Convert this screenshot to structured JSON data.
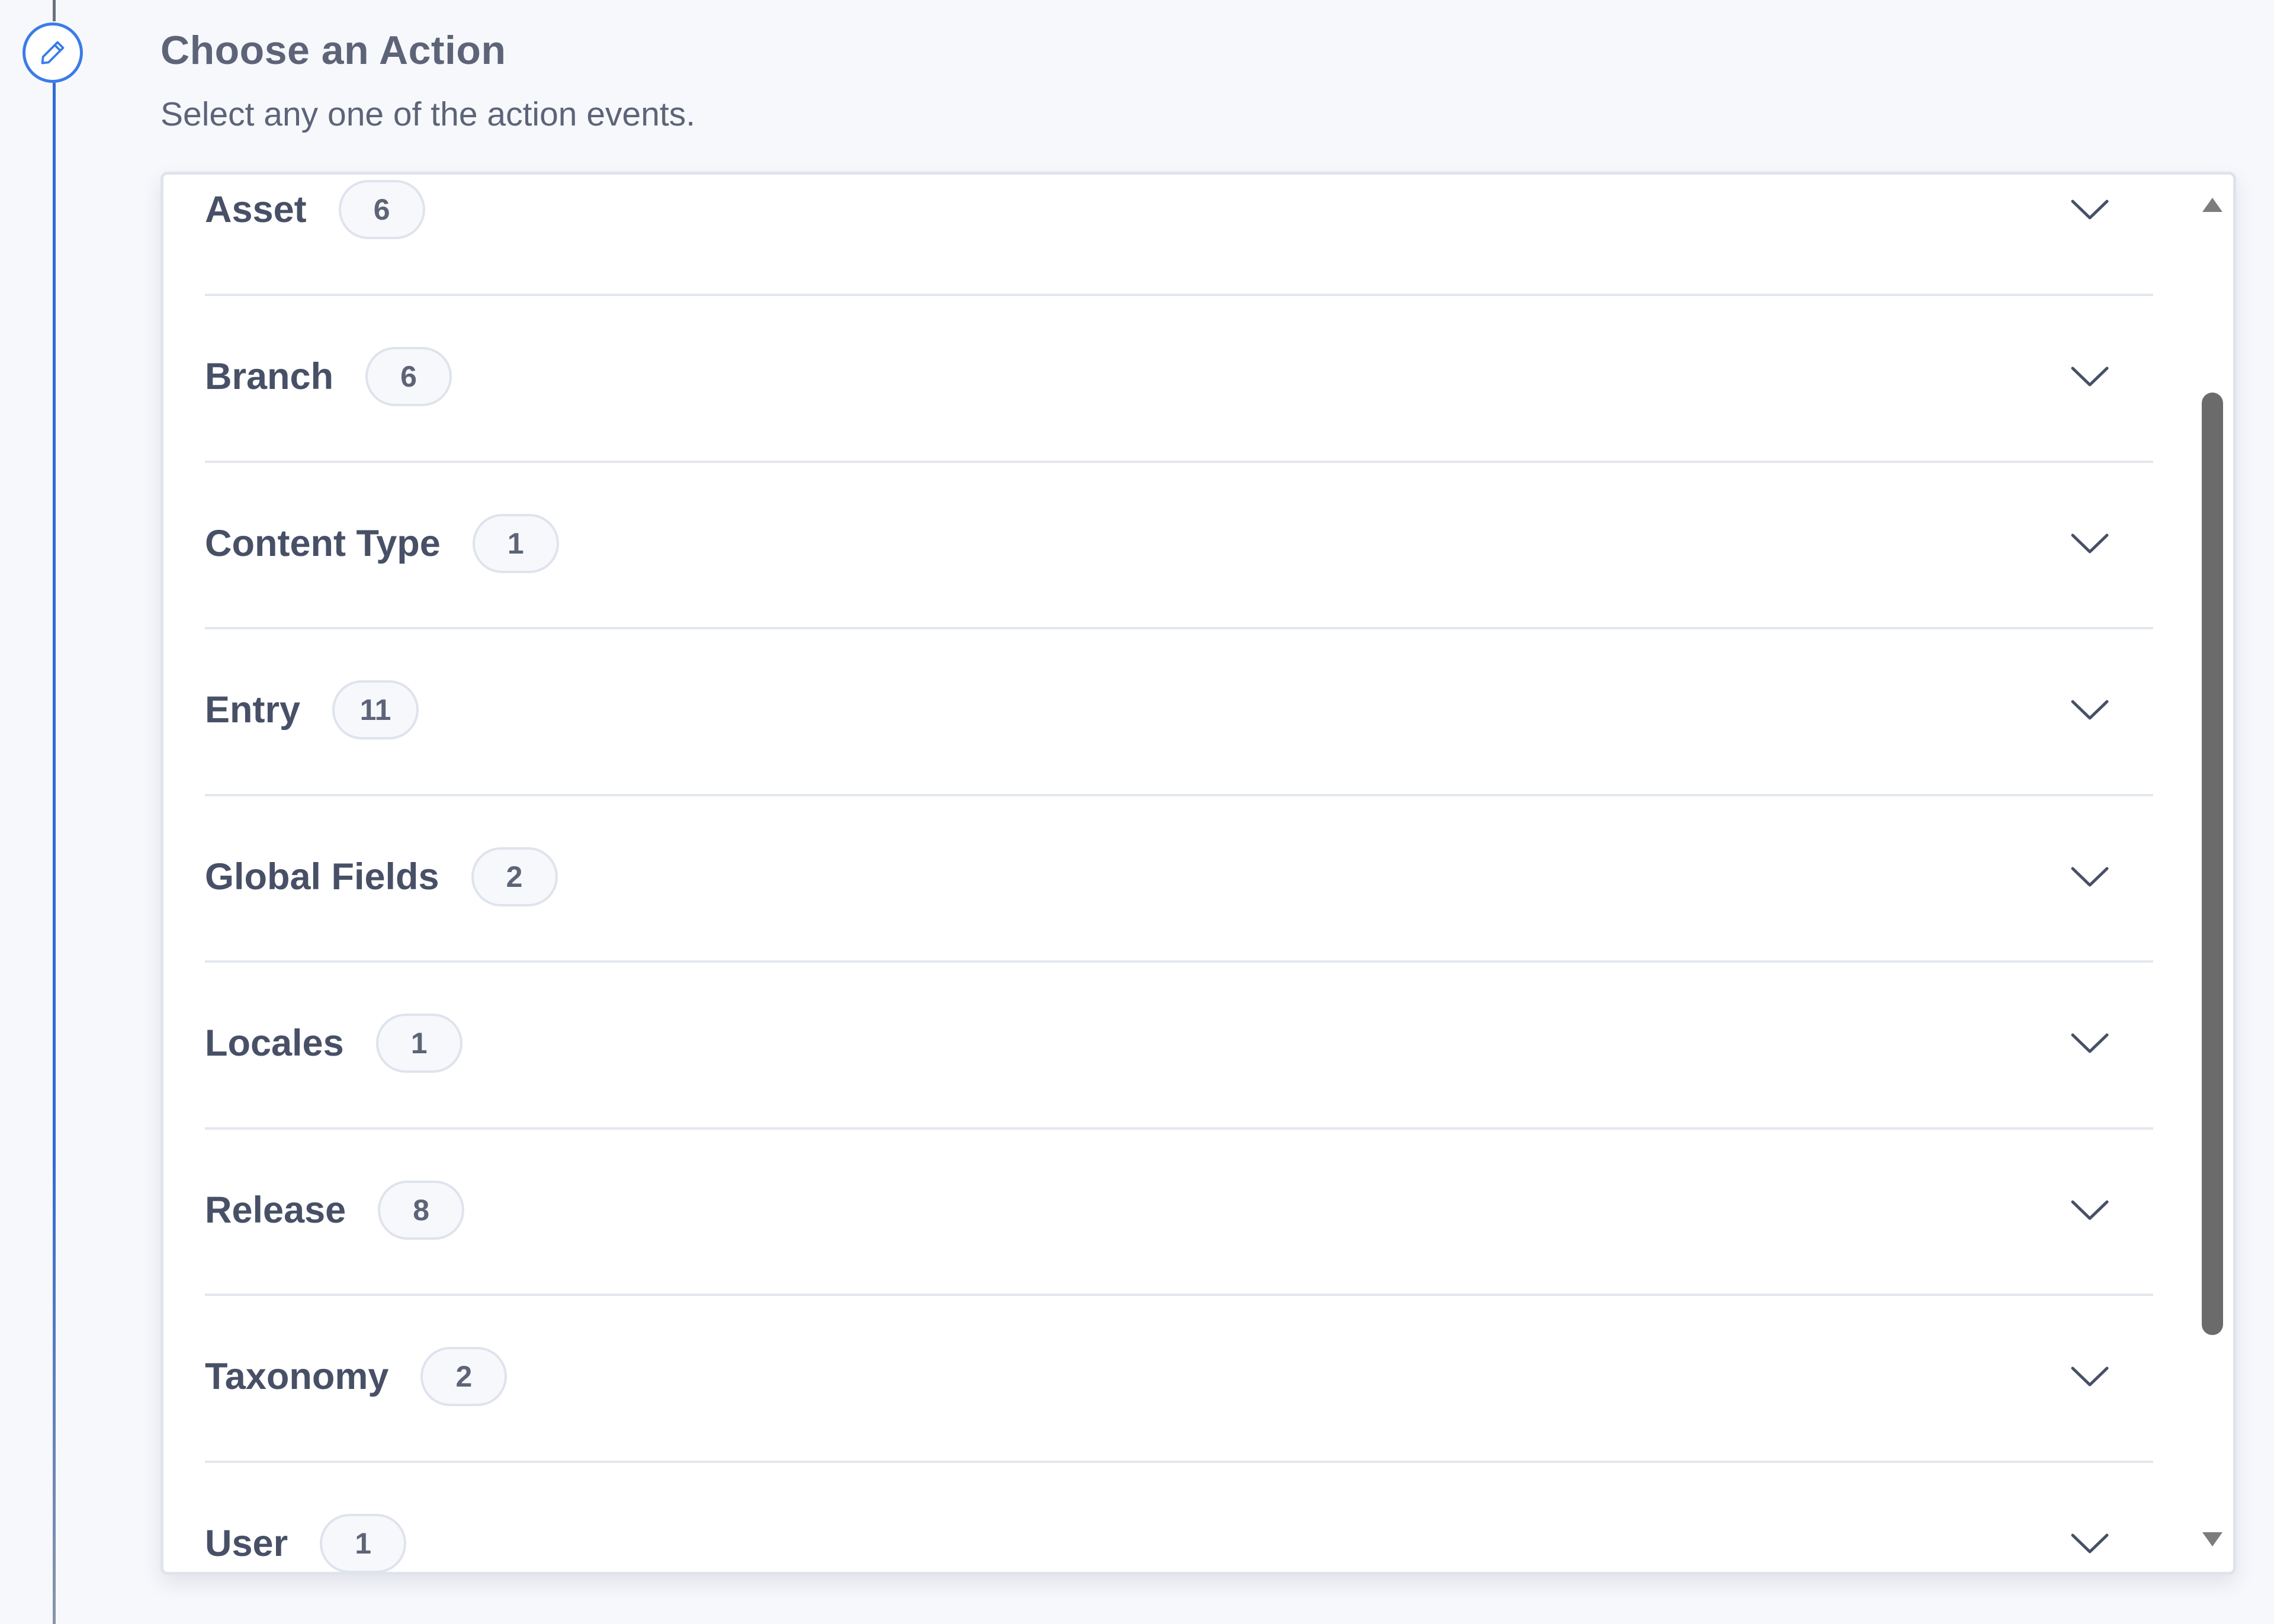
{
  "header": {
    "title": "Choose an Action",
    "subtitle": "Select any one of the action events."
  },
  "step": {
    "icon": "pencil-icon",
    "accent_color": "#3b7be8"
  },
  "actions": [
    {
      "label": "Asset",
      "count": "6"
    },
    {
      "label": "Branch",
      "count": "6"
    },
    {
      "label": "Content Type",
      "count": "1"
    },
    {
      "label": "Entry",
      "count": "11"
    },
    {
      "label": "Global Fields",
      "count": "2"
    },
    {
      "label": "Locales",
      "count": "1"
    },
    {
      "label": "Release",
      "count": "8"
    },
    {
      "label": "Taxonomy",
      "count": "2"
    },
    {
      "label": "User",
      "count": "1"
    }
  ],
  "icons": {
    "row_toggle": "chevron-down-icon",
    "scroll_up": "scroll-up-arrow-icon",
    "scroll_down": "scroll-down-arrow-icon"
  },
  "colors": {
    "text": "#475066",
    "muted_text": "#5d6478",
    "divider": "#e3e7ee",
    "rail": "#2e6bd6"
  }
}
